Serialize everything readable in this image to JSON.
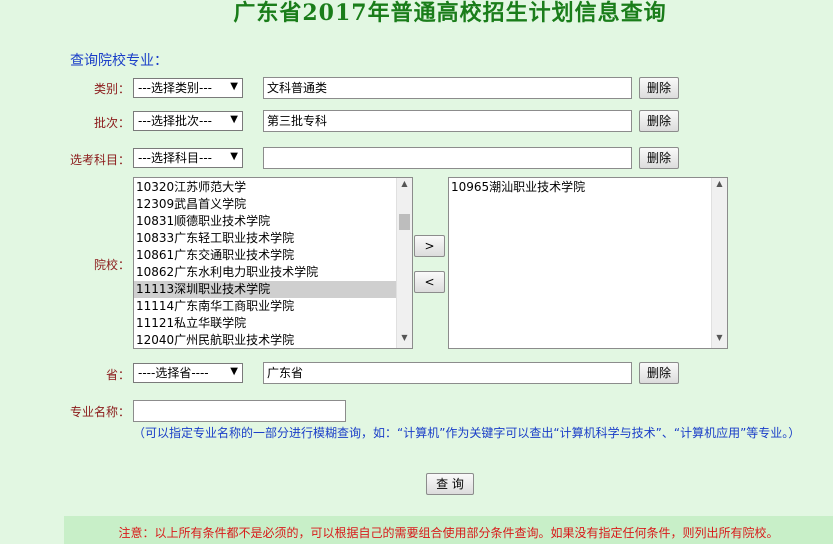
{
  "page": {
    "title": "广东省2017年普通高校招生计划信息查询",
    "section_label": "查询院校专业："
  },
  "form": {
    "category": {
      "label": "类别：",
      "select": "---选择类别---",
      "value": "文科普通类",
      "delete": "删除"
    },
    "batch": {
      "label": "批次：",
      "select": "---选择批次---",
      "value": "第三批专科",
      "delete": "删除"
    },
    "subject": {
      "label": "选考科目：",
      "select": "---选择科目---",
      "value": "",
      "delete": "删除"
    },
    "school": {
      "label": "院校：",
      "available": [
        "10320江苏师范大学",
        "12309武昌首义学院",
        "10831顺德职业技术学院",
        "10833广东轻工职业技术学院",
        "10861广东交通职业技术学院",
        "10862广东水利电力职业技术学院",
        "11113深圳职业技术学院",
        "11114广东南华工商职业学院",
        "11121私立华联学院",
        "12040广州民航职业技术学院"
      ],
      "selected_index": 6,
      "chosen": [
        "10965潮汕职业技术学院"
      ],
      "add_button": ">",
      "remove_button": "<"
    },
    "province": {
      "label": "省：",
      "select": "----选择省----",
      "value": "广东省",
      "delete": "删除"
    },
    "major": {
      "label": "专业名称：",
      "value": "",
      "hint": "（可以指定专业名称的一部分进行模糊查询，如：“计算机”作为关键字可以查出“计算机科学与技术”、“计算机应用”等专业。）"
    },
    "query_button": "查 询"
  },
  "note": "注意：以上所有条件都不是必须的，可以根据自己的需要组合使用部分条件查询。如果没有指定任何条件，则列出所有院校。",
  "icons": {
    "dropdown": "triangle-down-icon",
    "scroll_up": "triangle-up-icon",
    "scroll_down": "triangle-down-icon"
  },
  "colors": {
    "background": "#e2f7e2",
    "title": "#1a7d1a",
    "label": "#8b1a1a",
    "link_blue": "#1a3ec8",
    "note_red": "#d81a1a"
  }
}
